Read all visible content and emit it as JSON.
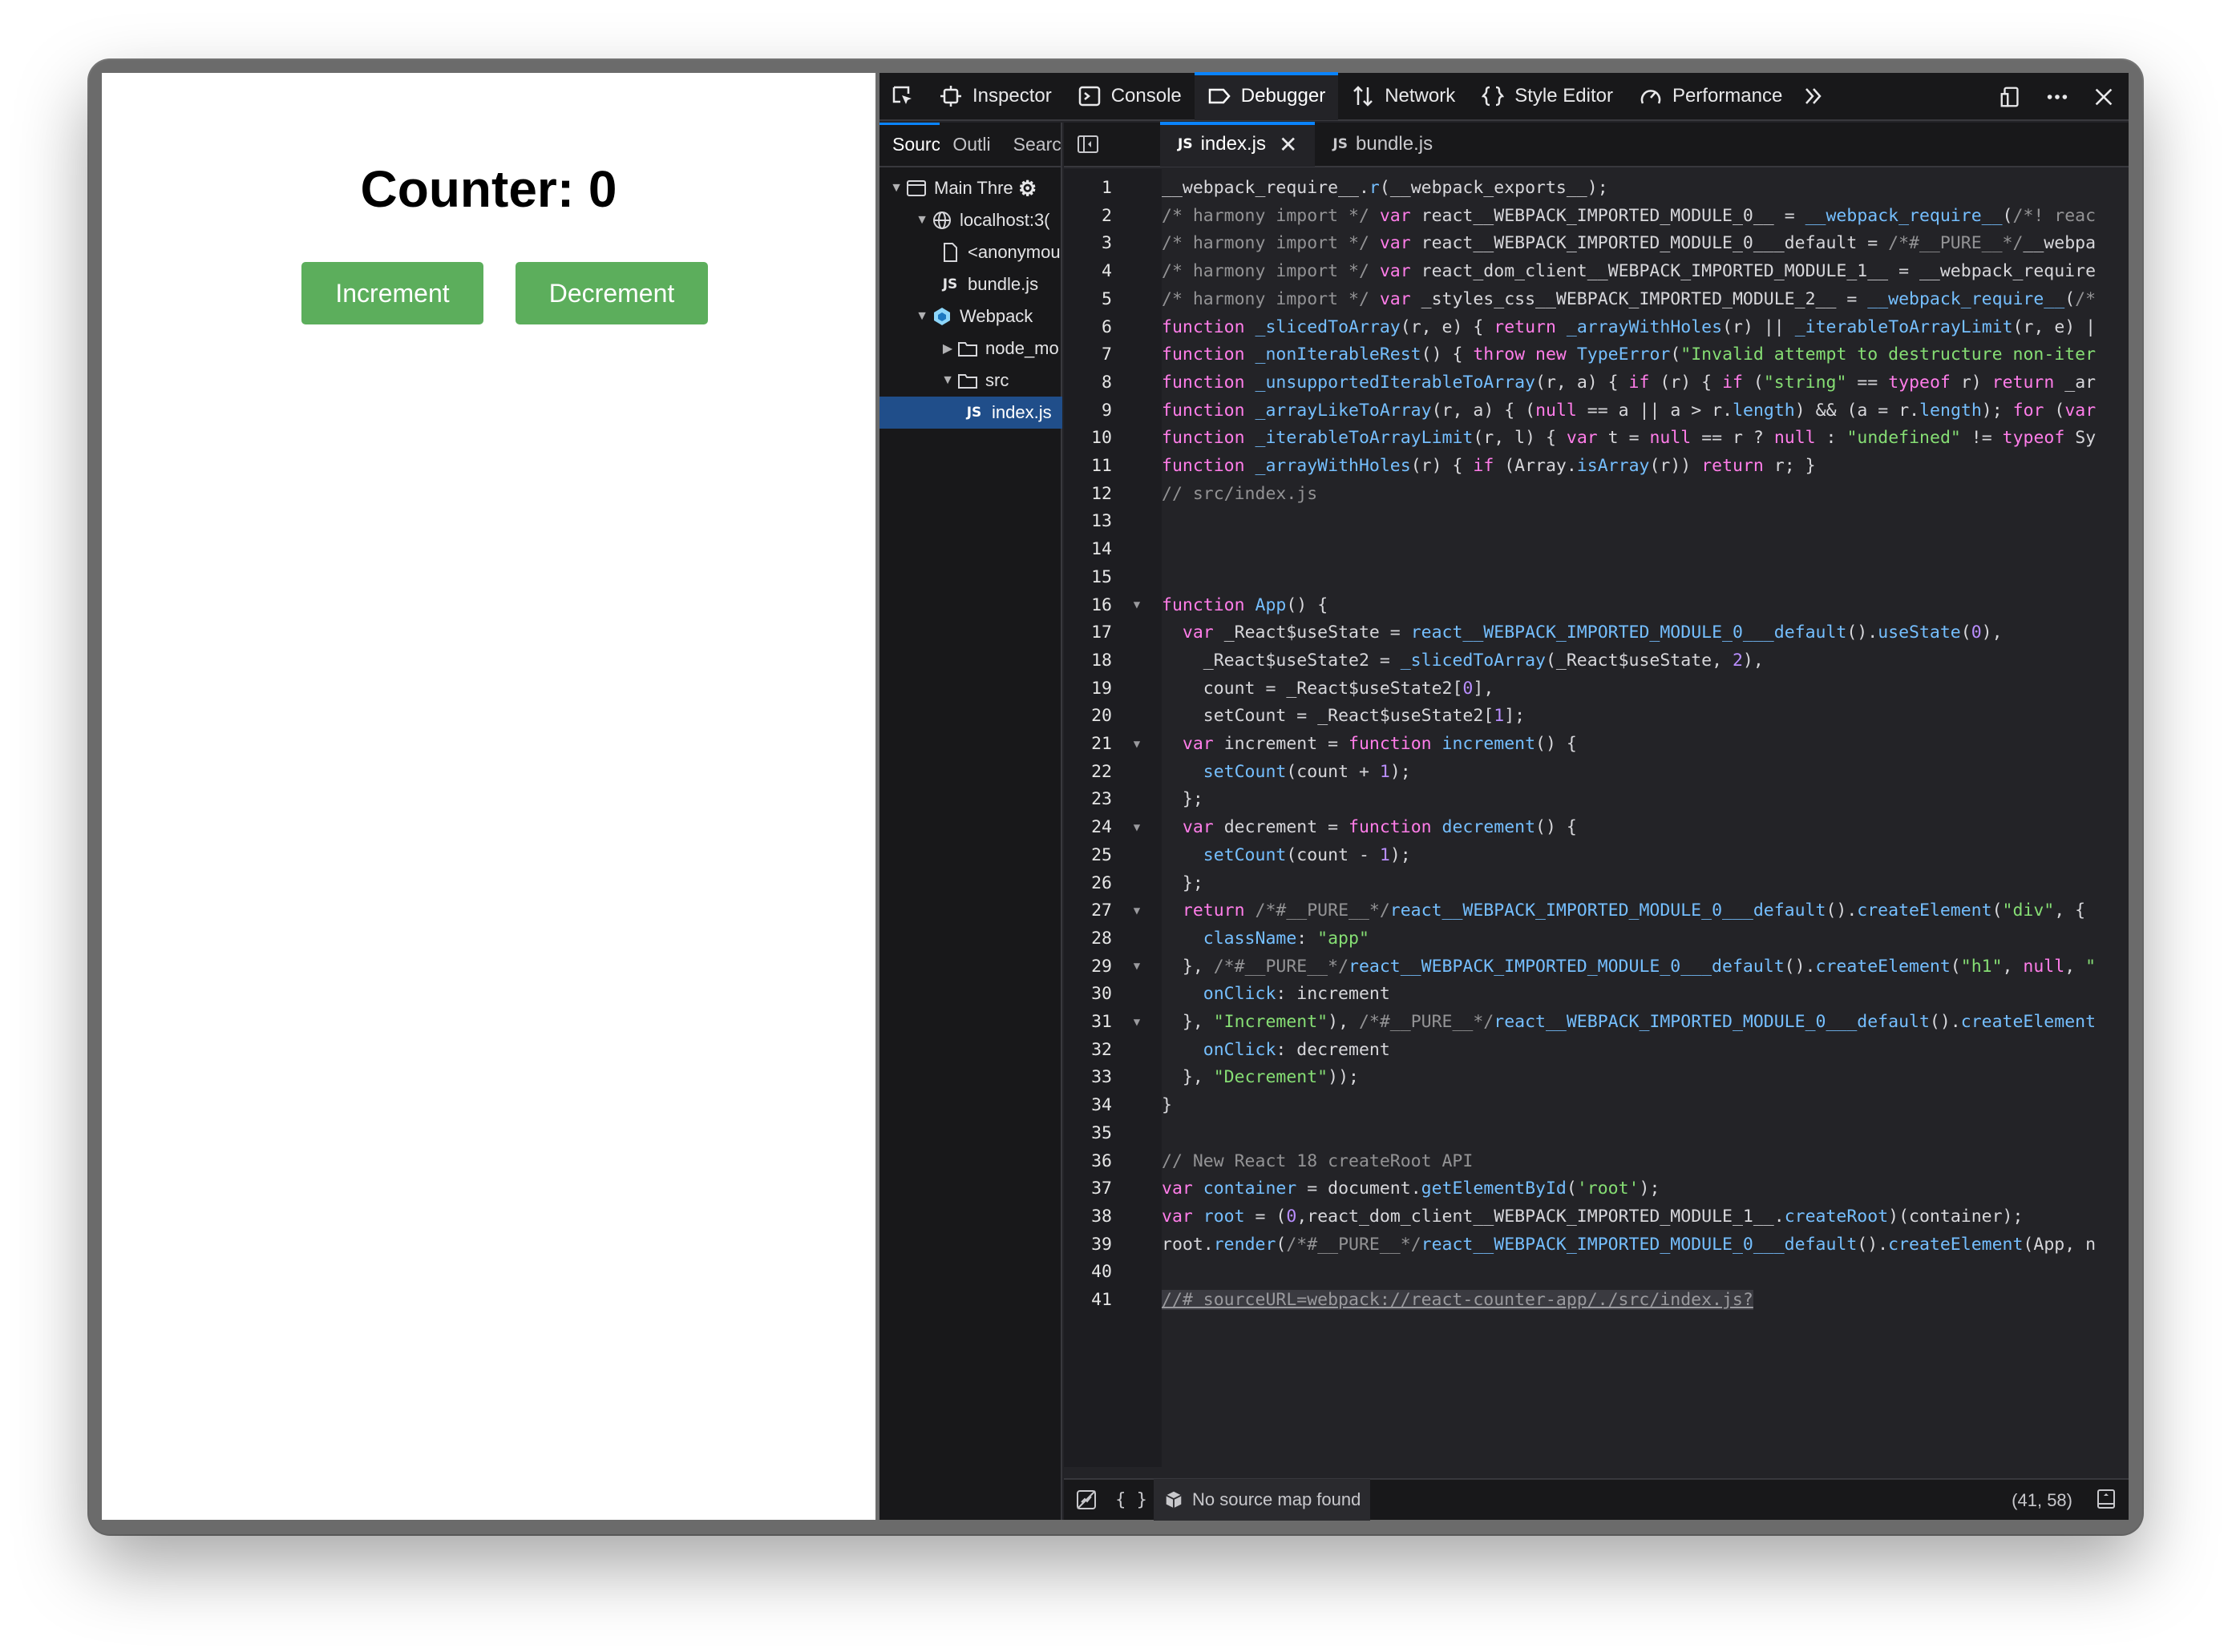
{
  "app": {
    "counter_title": "Counter: 0",
    "increment_label": "Increment",
    "decrement_label": "Decrement",
    "button_color": "#5cae5c"
  },
  "devtools": {
    "tabs": [
      {
        "label": "Inspector",
        "icon": "inspector-icon"
      },
      {
        "label": "Console",
        "icon": "console-icon"
      },
      {
        "label": "Debugger",
        "icon": "debugger-icon"
      },
      {
        "label": "Network",
        "icon": "network-icon"
      },
      {
        "label": "Style Editor",
        "icon": "style-editor-icon"
      },
      {
        "label": "Performance",
        "icon": "performance-icon"
      }
    ],
    "active_tab": "Debugger",
    "accent": "#0a84ff"
  },
  "sources": {
    "tabs": [
      "Sourc",
      "Outli",
      "Searc"
    ],
    "tree": [
      "Main Thre",
      "localhost:3(",
      "<anonymou",
      "bundle.js",
      "Webpack",
      "node_mo",
      "src",
      "index.js"
    ],
    "selected": "index.js",
    "js_badge": "JS"
  },
  "editor": {
    "tabs": [
      "index.js",
      "bundle.js"
    ],
    "close_glyph": "✕"
  },
  "code_lines": [
    "__webpack_require__.r(__webpack_exports__);",
    "/* harmony import */ var react__WEBPACK_IMPORTED_MODULE_0__ = __webpack_require__(/*! reac",
    "/* harmony import */ var react__WEBPACK_IMPORTED_MODULE_0___default = /*#__PURE__*/__webpa",
    "/* harmony import */ var react_dom_client__WEBPACK_IMPORTED_MODULE_1__ = __webpack_require",
    "/* harmony import */ var _styles_css__WEBPACK_IMPORTED_MODULE_2__ = __webpack_require__(/*",
    "function _slicedToArray(r, e) { return _arrayWithHoles(r) || _iterableToArrayLimit(r, e) |",
    "function _nonIterableRest() { throw new TypeError(\"Invalid attempt to destructure non-iter",
    "function _unsupportedIterableToArray(r, a) { if (r) { if (\"string\" == typeof r) return _ar",
    "function _arrayLikeToArray(r, a) { (null == a || a > r.length) && (a = r.length); for (var",
    "function _iterableToArrayLimit(r, l) { var t = null == r ? null : \"undefined\" != typeof Sy",
    "function _arrayWithHoles(r) { if (Array.isArray(r)) return r; }",
    "// src/index.js",
    "",
    "",
    "",
    "function App() {",
    "  var _React$useState = react__WEBPACK_IMPORTED_MODULE_0___default().useState(0),",
    "    _React$useState2 = _slicedToArray(_React$useState, 2),",
    "    count = _React$useState2[0],",
    "    setCount = _React$useState2[1];",
    "  var increment = function increment() {",
    "    setCount(count + 1);",
    "  };",
    "  var decrement = function decrement() {",
    "    setCount(count - 1);",
    "  };",
    "  return /*#__PURE__*/react__WEBPACK_IMPORTED_MODULE_0___default().createElement(\"div\", {",
    "    className: \"app\"",
    "  }, /*#__PURE__*/react__WEBPACK_IMPORTED_MODULE_0___default().createElement(\"h1\", null, \"",
    "    onClick: increment",
    "  }, \"Increment\"), /*#__PURE__*/react__WEBPACK_IMPORTED_MODULE_0___default().createElement",
    "    onClick: decrement",
    "  }, \"Decrement\"));",
    "}",
    "",
    "// New React 18 createRoot API",
    "var container = document.getElementById('root');",
    "var root = (0,react_dom_client__WEBPACK_IMPORTED_MODULE_1__.createRoot)(container);",
    "root.render(/*#__PURE__*/react__WEBPACK_IMPORTED_MODULE_0___default().createElement(App, n",
    "",
    "//# sourceURL=webpack://react-counter-app/./src/index.js?"
  ],
  "fold_lines": [
    16,
    21,
    24,
    27,
    29,
    31
  ],
  "status": {
    "sourcemap": "No source map found",
    "cursor": "(41, 58)",
    "pretty_print": "{ }"
  }
}
